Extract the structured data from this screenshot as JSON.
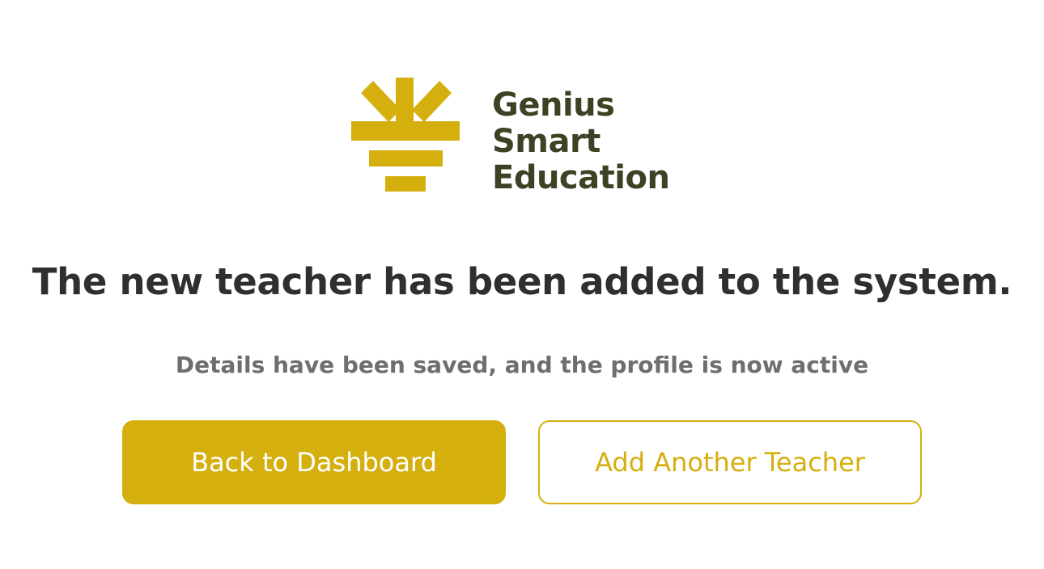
{
  "brand": {
    "name_lines": [
      "Genius",
      "Smart",
      "Education"
    ],
    "logo_icon": "sunrise-lamp-icon",
    "accent_color": "#d4af0e",
    "text_color": "#3d4224"
  },
  "confirmation": {
    "headline": "The new teacher has been added to the system.",
    "subline": "Details have been saved, and the profile is now active"
  },
  "actions": {
    "primary_label": "Back to Dashboard",
    "secondary_label": "Add Another Teacher"
  }
}
